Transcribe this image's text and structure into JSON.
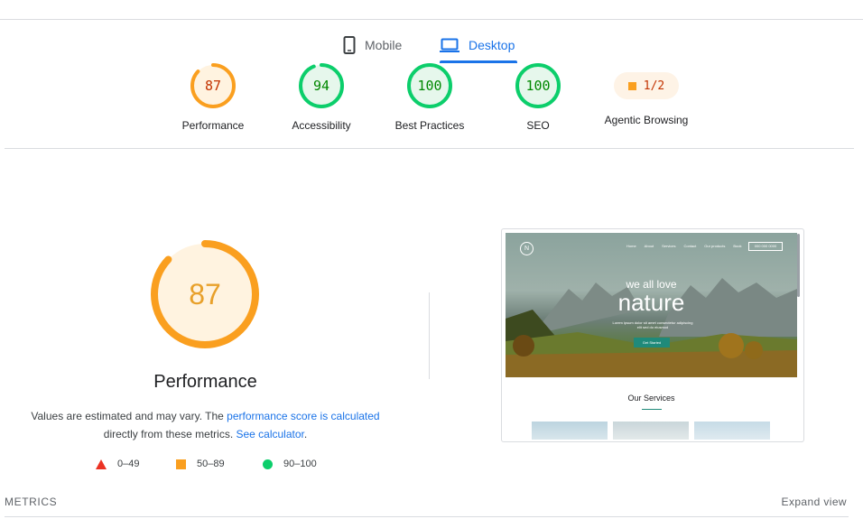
{
  "tabs": {
    "mobile_label": "Mobile",
    "desktop_label": "Desktop",
    "active": "Desktop"
  },
  "gauges": [
    {
      "label": "Performance",
      "score": "87",
      "fraction": 0.87,
      "color": "#fa9f1f",
      "fill": "#fff3e0",
      "text": "#c33300"
    },
    {
      "label": "Accessibility",
      "score": "94",
      "fraction": 0.94,
      "color": "#0cce6b",
      "fill": "#e6f7ec",
      "text": "#008800"
    },
    {
      "label": "Best Practices",
      "score": "100",
      "fraction": 1.0,
      "color": "#0cce6b",
      "fill": "#e6f7ec",
      "text": "#008800"
    },
    {
      "label": "SEO",
      "score": "100",
      "fraction": 1.0,
      "color": "#0cce6b",
      "fill": "#e6f7ec",
      "text": "#008800"
    }
  ],
  "agentic": {
    "label": "Agentic Browsing",
    "value": "1/2",
    "color": "#fa9f1f"
  },
  "performance": {
    "score": "87",
    "fraction": 0.87,
    "title": "Performance",
    "desc_pre": "Values are estimated and may vary. The ",
    "desc_link": "performance score is calculated",
    "desc_mid": " directly from these metrics. ",
    "desc_link2": "See calculator",
    "desc_post": ".",
    "color": "#fa9f1f"
  },
  "legend": [
    {
      "range": "0–49",
      "symbol": "triangle",
      "color": "#eb3223"
    },
    {
      "range": "50–89",
      "symbol": "square",
      "color": "#fa9f1f"
    },
    {
      "range": "90–100",
      "symbol": "circle",
      "color": "#0cce6b"
    }
  ],
  "thumbnail": {
    "logo": "N",
    "nav": [
      "Home",
      "About",
      "Services",
      "Contact",
      "Our products",
      "Book"
    ],
    "nav_button": "000 000 0000",
    "hero_small": "we all love",
    "hero_big": "nature",
    "hero_sub": "Lorem ipsum dolor sit amet consectetur adipiscing elit sed do eiusmod",
    "hero_button": "Get Started",
    "services_title": "Our Services"
  },
  "footer": {
    "metrics_label": "METRICS",
    "expand_label": "Expand view"
  }
}
